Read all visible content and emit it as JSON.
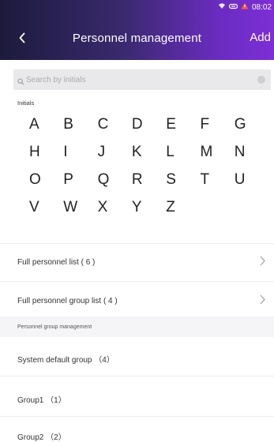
{
  "status_bar": {
    "time": "08:02"
  },
  "header": {
    "back_icon": "chevron-left-icon",
    "title": "Personnel management",
    "add_label": "Add"
  },
  "search": {
    "placeholder": "Search by initials",
    "value": ""
  },
  "initials": {
    "label": "Initials",
    "letters": [
      "A",
      "B",
      "C",
      "D",
      "E",
      "F",
      "G",
      "H",
      "I",
      "J",
      "K",
      "L",
      "M",
      "N",
      "O",
      "P",
      "Q",
      "R",
      "S",
      "T",
      "U",
      "V",
      "W",
      "X",
      "Y",
      "Z"
    ]
  },
  "lists": {
    "full_personnel": "Full personnel list ( 6 )",
    "full_group": "Full personnel group list ( 4 )"
  },
  "group_management": {
    "section_title": "Personnel group management",
    "groups": [
      "System default group （4）",
      "Group1 （1）",
      "Group2 （2）"
    ]
  },
  "colors": {
    "header_start": "#1c1a3c",
    "header_end": "#7c2fd6"
  }
}
